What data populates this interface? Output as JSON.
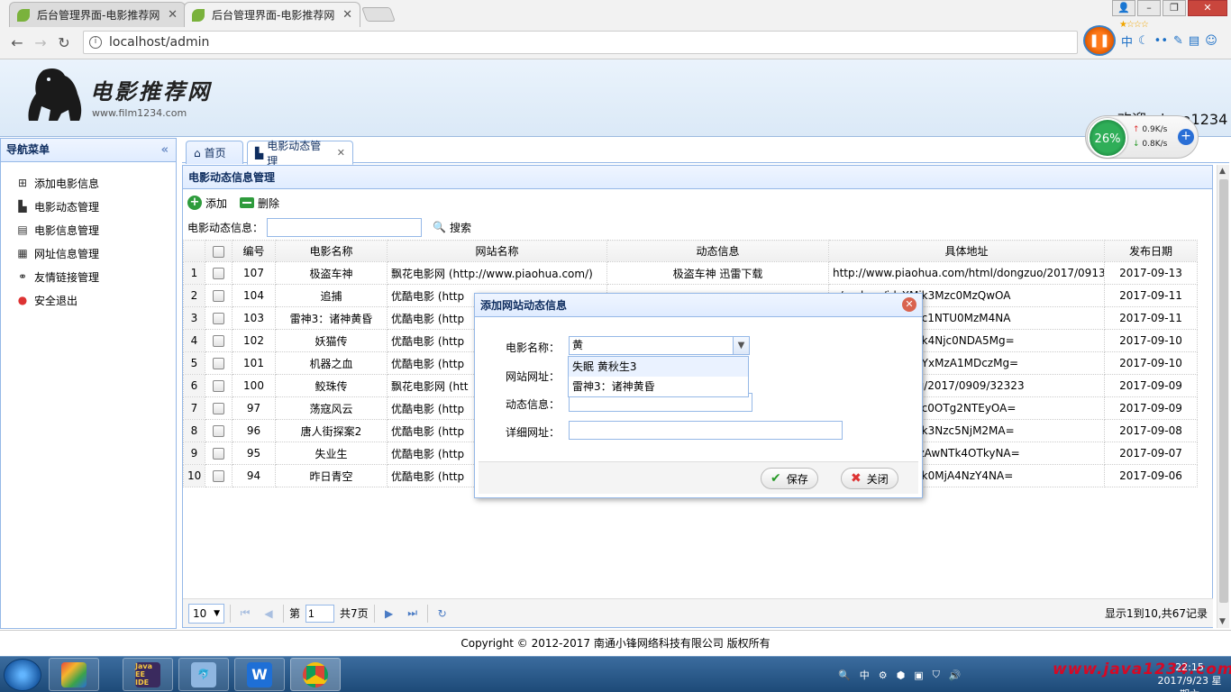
{
  "browser": {
    "tabs": [
      {
        "title": "后台管理界面-电影推荐网"
      },
      {
        "title": "后台管理界面-电影推荐网"
      }
    ],
    "url": "localhost/admin"
  },
  "header": {
    "logo_title": "电影推荐网",
    "logo_url": "www.film1234.com",
    "welcome": "欢迎：java1234"
  },
  "speed_widget": {
    "percent": "26%",
    "up": "0.9K/s",
    "down": "0.8K/s"
  },
  "nav": {
    "title": "导航菜单",
    "items": [
      {
        "label": "添加电影信息",
        "icon": "add-icon"
      },
      {
        "label": "电影动态管理",
        "icon": "chart-icon"
      },
      {
        "label": "电影信息管理",
        "icon": "film-icon"
      },
      {
        "label": "网址信息管理",
        "icon": "table-icon"
      },
      {
        "label": "友情链接管理",
        "icon": "link-icon"
      },
      {
        "label": "安全退出",
        "icon": "exit-icon"
      }
    ]
  },
  "page_tabs": [
    {
      "label": "首页",
      "icon": "home-icon"
    },
    {
      "label": "电影动态管理",
      "icon": "chart-icon"
    }
  ],
  "panel": {
    "title": "电影动态信息管理",
    "add_label": "添加",
    "delete_label": "删除",
    "search_label": "电影动态信息：",
    "search_value": "",
    "search_button": "搜索"
  },
  "grid": {
    "columns": [
      "编号",
      "电影名称",
      "网站名称",
      "动态信息",
      "具体地址",
      "发布日期"
    ],
    "rows": [
      {
        "n": "1",
        "id": "107",
        "film": "极盗车神",
        "site": "飘花电影网 (http://www.piaohua.com/)",
        "info": "极盗车神 迅雷下载",
        "url": "http://www.piaohua.com/html/dongzuo/2017/0913/",
        "date": "2017-09-13"
      },
      {
        "n": "2",
        "id": "104",
        "film": "追捕",
        "site": "优酷电影 (http",
        "info": "",
        "url": "n/v_show/id_XMjk3Mzc0MzQwOA",
        "date": "2017-09-11"
      },
      {
        "n": "3",
        "id": "103",
        "film": "雷神3：诸神黄昏",
        "site": "优酷电影 (http",
        "info": "",
        "url": "n/v_show/id_XMjc1NTU0MzM4NA",
        "date": "2017-09-11"
      },
      {
        "n": "4",
        "id": "102",
        "film": "妖猫传",
        "site": "优酷电影 (http",
        "info": "",
        "url": "n/v_show/id_XMjk4Njc0NDA5Mg=",
        "date": "2017-09-10"
      },
      {
        "n": "5",
        "id": "101",
        "film": "机器之血",
        "site": "优酷电影 (http",
        "info": "",
        "url": "n/v_show/id_XMjYxMzA1MDczMg=",
        "date": "2017-09-10"
      },
      {
        "n": "6",
        "id": "100",
        "film": "鲛珠传",
        "site": "飘花电影网 (htt",
        "info": "",
        "url": "ua.com/html/xiju/2017/0909/32323",
        "date": "2017-09-09"
      },
      {
        "n": "7",
        "id": "97",
        "film": "荡寇风云",
        "site": "优酷电影 (http",
        "info": "",
        "url": "n/v_show/id_XMjc0OTg2NTEyOA=",
        "date": "2017-09-09"
      },
      {
        "n": "8",
        "id": "96",
        "film": "唐人街探案2",
        "site": "优酷电影 (http",
        "info": "",
        "url": "n/v_show/id_XMjk3Nzc5NjM2MA=",
        "date": "2017-09-08"
      },
      {
        "n": "9",
        "id": "95",
        "film": "失业生",
        "site": "优酷电影 (http",
        "info": "",
        "url": "n/v_show/id_XMzAwNTk4OTkyNA=",
        "date": "2017-09-07"
      },
      {
        "n": "10",
        "id": "94",
        "film": "昨日青空",
        "site": "优酷电影 (http",
        "info": "",
        "url": "n/v_show/id_XMjk0MjA4NzY4NA=",
        "date": "2017-09-06"
      }
    ]
  },
  "pager": {
    "page_size": "10",
    "page_prefix": "第",
    "page_value": "1",
    "page_suffix": "共7页",
    "info": "显示1到10,共67记录"
  },
  "footer": "Copyright © 2012-2017 南通小锋网络科技有限公司 版权所有",
  "dialog": {
    "title": "添加网站动态信息",
    "film_label": "电影名称：",
    "film_value": "黄",
    "site_label": "网站网址：",
    "info_label": "动态信息：",
    "url_label": "详细网址：",
    "options": [
      "失眠 黄秋生3",
      "雷神3：诸神黄昏"
    ],
    "save_label": "保存",
    "close_label": "关闭"
  },
  "taskbar": {
    "apps": [
      "Java EE IDE",
      "",
      "",
      ""
    ],
    "tray_lang": "中",
    "time": "22:15",
    "date": "2017/9/23 星期六",
    "watermark": "www.java1234.com"
  }
}
